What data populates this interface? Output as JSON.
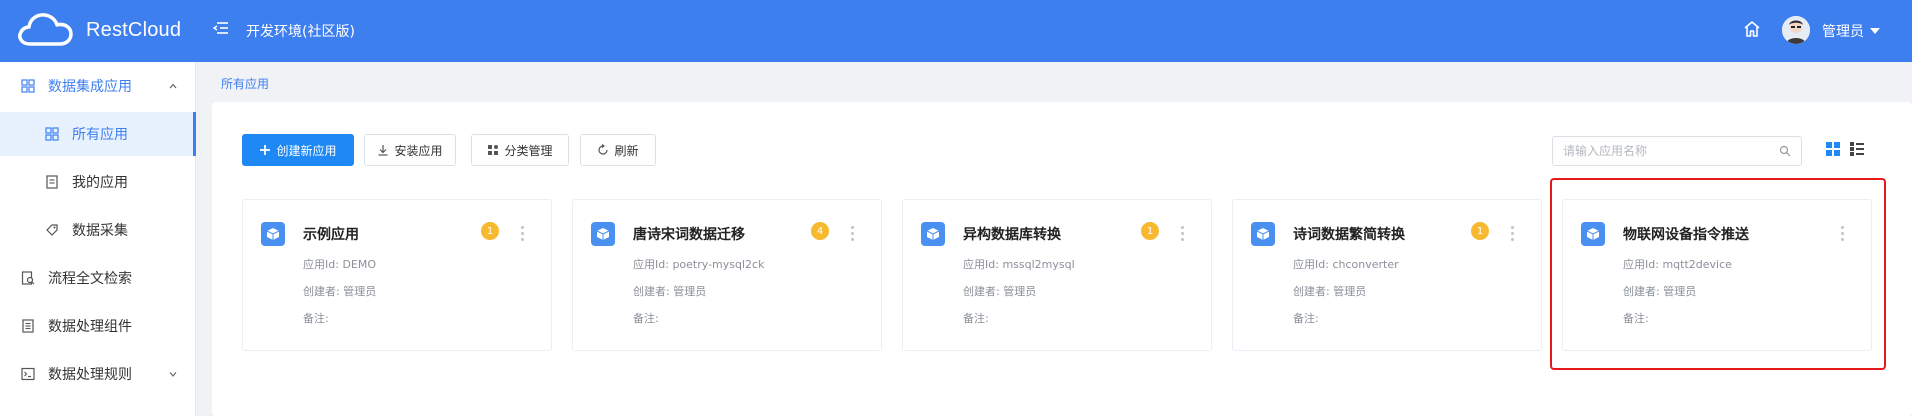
{
  "header": {
    "app_name": "RestCloud",
    "env_title": "开发环境(社区版)",
    "user_name": "管理员"
  },
  "sidebar": {
    "items": [
      {
        "label": "数据集成应用",
        "icon": "grid-icon",
        "state": "expanded-group"
      },
      {
        "label": "所有应用",
        "icon": "grid-icon",
        "state": "active"
      },
      {
        "label": "我的应用",
        "icon": "document-icon",
        "state": ""
      },
      {
        "label": "数据采集",
        "icon": "tag-icon",
        "state": ""
      },
      {
        "label": "流程全文检索",
        "icon": "search-doc-icon",
        "state": ""
      },
      {
        "label": "数据处理组件",
        "icon": "list-doc-icon",
        "state": ""
      },
      {
        "label": "数据处理规则",
        "icon": "terminal-icon",
        "state": "collapsed-group"
      }
    ]
  },
  "breadcrumb": {
    "label": "所有应用"
  },
  "toolbar": {
    "create_label": "创建新应用",
    "install_label": "安装应用",
    "category_label": "分类管理",
    "refresh_label": "刷新",
    "search_placeholder": "请输入应用名称"
  },
  "cards": [
    {
      "name": "示例应用",
      "badge": "1",
      "app_id_label": "应用Id:",
      "app_id": "DEMO",
      "creator_label": "创建者:",
      "creator": "管理员",
      "note_label": "备注:",
      "note": ""
    },
    {
      "name": "唐诗宋词数据迁移",
      "badge": "4",
      "app_id_label": "应用Id:",
      "app_id": "poetry-mysql2ck",
      "creator_label": "创建者:",
      "creator": "管理员",
      "note_label": "备注:",
      "note": ""
    },
    {
      "name": "异构数据库转换",
      "badge": "1",
      "app_id_label": "应用Id:",
      "app_id": "mssql2mysql",
      "creator_label": "创建者:",
      "creator": "管理员",
      "note_label": "备注:",
      "note": ""
    },
    {
      "name": "诗词数据繁简转换",
      "badge": "1",
      "app_id_label": "应用Id:",
      "app_id": "chconverter",
      "creator_label": "创建者:",
      "creator": "管理员",
      "note_label": "备注:",
      "note": ""
    },
    {
      "name": "物联网设备指令推送",
      "badge": "",
      "app_id_label": "应用Id:",
      "app_id": "mqtt2device",
      "creator_label": "创建者:",
      "creator": "管理员",
      "note_label": "备注:",
      "note": ""
    }
  ],
  "colors": {
    "header_bg": "#3e7ff0",
    "primary": "#1e88f5",
    "badge": "#f7b92f",
    "highlight": "#e5191c"
  }
}
